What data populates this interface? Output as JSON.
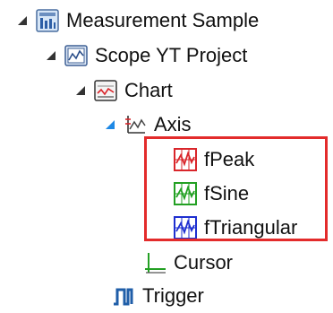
{
  "tree": {
    "root": {
      "label": "Measurement Sample",
      "icon": "measurement-project-icon",
      "expanded": true
    },
    "project": {
      "label": "Scope YT Project",
      "icon": "scope-project-icon",
      "expanded": true
    },
    "chart": {
      "label": "Chart",
      "icon": "chart-icon",
      "expanded": true
    },
    "axis": {
      "label": "Axis",
      "icon": "axis-icon",
      "expanded": true,
      "selected_arrow_color": "#1e88e5"
    },
    "channels": [
      {
        "label": "fPeak",
        "icon": "channel-icon",
        "color": "#d9262b"
      },
      {
        "label": "fSine",
        "icon": "channel-icon",
        "color": "#23a023"
      },
      {
        "label": "fTriangular",
        "icon": "channel-icon",
        "color": "#1e2fd0"
      }
    ],
    "cursor": {
      "label": "Cursor",
      "icon": "cursor-icon"
    },
    "trigger": {
      "label": "Trigger",
      "icon": "trigger-icon"
    }
  },
  "highlight_color": "#e32b2b"
}
